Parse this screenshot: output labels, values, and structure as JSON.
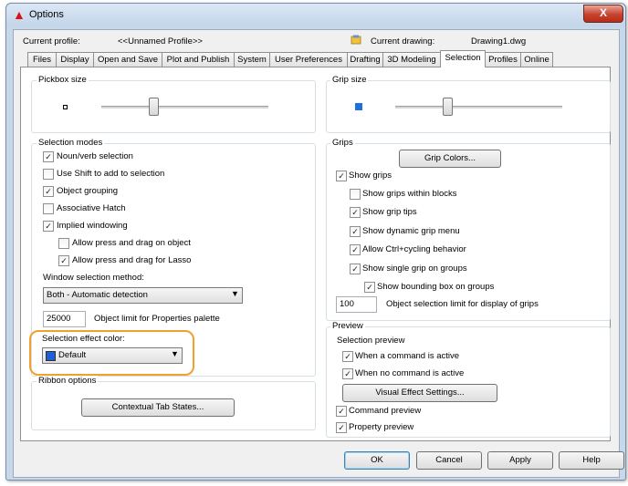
{
  "window": {
    "title": "Options",
    "close_label": "X"
  },
  "header": {
    "current_profile_label": "Current profile:",
    "current_profile_value": "<<Unnamed Profile>>",
    "current_drawing_label": "Current drawing:",
    "current_drawing_value": "Drawing1.dwg"
  },
  "tabs": [
    {
      "label": "Files"
    },
    {
      "label": "Display"
    },
    {
      "label": "Open and Save"
    },
    {
      "label": "Plot and Publish"
    },
    {
      "label": "System"
    },
    {
      "label": "User Preferences"
    },
    {
      "label": "Drafting"
    },
    {
      "label": "3D Modeling"
    },
    {
      "label": "Selection",
      "active": true
    },
    {
      "label": "Profiles"
    },
    {
      "label": "Online"
    }
  ],
  "pickbox": {
    "title": "Pickbox size",
    "level": 0.3
  },
  "grip_size": {
    "title": "Grip size",
    "level": 0.3
  },
  "selection_modes": {
    "title": "Selection modes",
    "noun_verb": {
      "label": "Noun/verb selection",
      "checked": true
    },
    "use_shift": {
      "label": "Use Shift to add to selection",
      "checked": false
    },
    "object_grouping": {
      "label": "Object grouping",
      "checked": true
    },
    "assoc_hatch": {
      "label": "Associative Hatch",
      "checked": false
    },
    "implied_windowing": {
      "label": "Implied windowing",
      "checked": true
    },
    "press_drag_object": {
      "label": "Allow press and drag on object",
      "checked": false
    },
    "press_drag_lasso": {
      "label": "Allow press and drag for Lasso",
      "checked": true
    },
    "window_method_label": "Window selection method:",
    "window_method_value": "Both - Automatic detection",
    "object_limit_value": "25000",
    "object_limit_label": "Object limit for Properties palette",
    "effect_color_label": "Selection effect color:",
    "effect_color_value": "Default",
    "effect_color_swatch": "#1e5fd8",
    "highlight_color": "#f0a030"
  },
  "ribbon": {
    "title": "Ribbon options",
    "contextual_button": "Contextual Tab States..."
  },
  "grips": {
    "title": "Grips",
    "grip_colors_button": "Grip Colors...",
    "show_grips": {
      "label": "Show grips",
      "checked": true
    },
    "within_blocks": {
      "label": "Show grips within blocks",
      "checked": false
    },
    "grip_tips": {
      "label": "Show grip tips",
      "checked": true
    },
    "dynamic_menu": {
      "label": "Show dynamic grip menu",
      "checked": true
    },
    "ctrl_cycling": {
      "label": "Allow Ctrl+cycling behavior",
      "checked": true
    },
    "single_grip": {
      "label": "Show single grip on groups",
      "checked": true
    },
    "bounding_box": {
      "label": "Show bounding box on groups",
      "checked": true
    },
    "limit_value": "100",
    "limit_label": "Object selection limit for display of grips",
    "grip_swatch": "#1e6fe0"
  },
  "preview": {
    "title": "Preview",
    "subtitle": "Selection preview",
    "command_active": {
      "label": "When a command is active",
      "checked": true
    },
    "no_command": {
      "label": "When no command is active",
      "checked": true
    },
    "visual_effect_button": "Visual Effect Settings...",
    "command_preview": {
      "label": "Command preview",
      "checked": true
    },
    "property_preview": {
      "label": "Property preview",
      "checked": true
    }
  },
  "footer": {
    "ok": "OK",
    "cancel": "Cancel",
    "apply": "Apply",
    "help": "Help"
  }
}
